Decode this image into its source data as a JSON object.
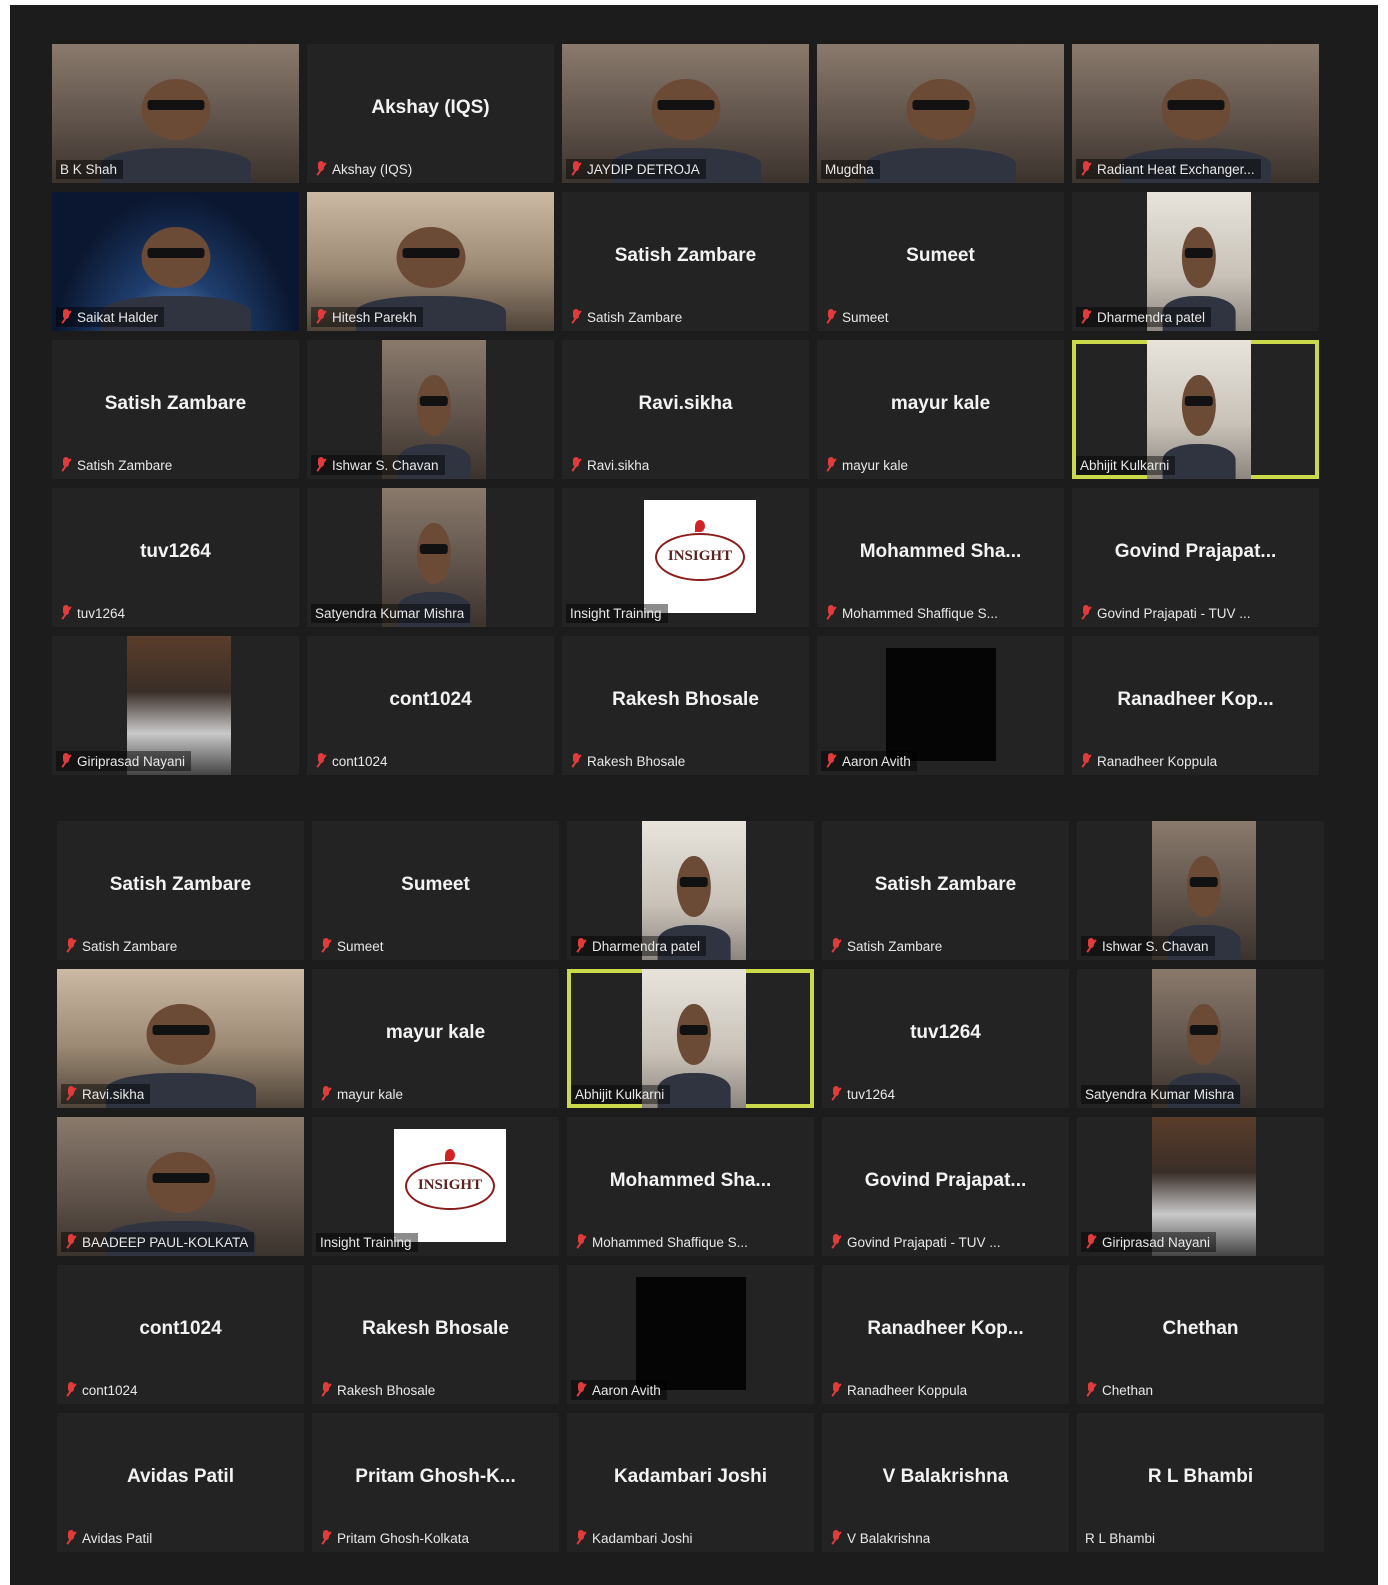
{
  "colors": {
    "background": "#1c1c1c",
    "tile": "#232323",
    "active_border": "#c9d94a",
    "muted_icon": "#e23b3b"
  },
  "panels": [
    {
      "tiles": [
        {
          "name": "",
          "label": "B K Shah",
          "muted": false,
          "video": "full",
          "active": false
        },
        {
          "name": "Akshay (IQS)",
          "label": "Akshay (IQS)",
          "muted": true,
          "video": "none",
          "active": false
        },
        {
          "name": "",
          "label": "JAYDIP DETROJA",
          "muted": true,
          "video": "full",
          "active": false
        },
        {
          "name": "",
          "label": "Mugdha",
          "muted": false,
          "video": "full",
          "active": false
        },
        {
          "name": "",
          "label": "Radiant Heat Exchanger...",
          "muted": true,
          "video": "full",
          "active": false
        },
        {
          "name": "",
          "label": "Saikat Halder",
          "muted": true,
          "video": "space",
          "active": false
        },
        {
          "name": "",
          "label": "Hitesh Parekh",
          "muted": true,
          "video": "room",
          "active": false
        },
        {
          "name": "Satish Zambare",
          "label": "Satish Zambare",
          "muted": true,
          "video": "none",
          "active": false
        },
        {
          "name": "Sumeet",
          "label": "Sumeet",
          "muted": true,
          "video": "none",
          "active": false
        },
        {
          "name": "",
          "label": "Dharmendra patel",
          "muted": true,
          "video": "narrow-bright",
          "active": false
        },
        {
          "name": "Satish Zambare",
          "label": "Satish Zambare",
          "muted": true,
          "video": "none",
          "active": false
        },
        {
          "name": "",
          "label": "Ishwar S. Chavan",
          "muted": true,
          "video": "narrow",
          "active": false
        },
        {
          "name": "Ravi.sikha",
          "label": "Ravi.sikha",
          "muted": true,
          "video": "none",
          "active": false
        },
        {
          "name": "mayur kale",
          "label": "mayur kale",
          "muted": true,
          "video": "none",
          "active": false
        },
        {
          "name": "",
          "label": "Abhijit Kulkarni",
          "muted": false,
          "video": "narrow-bright",
          "active": true
        },
        {
          "name": "tuv1264",
          "label": "tuv1264",
          "muted": true,
          "video": "none",
          "active": false
        },
        {
          "name": "",
          "label": "Satyendra Kumar Mishra",
          "muted": false,
          "video": "narrow",
          "active": false
        },
        {
          "name": "",
          "label": "Insight Training",
          "muted": false,
          "video": "logo",
          "active": false
        },
        {
          "name": "Mohammed  Sha...",
          "label": "Mohammed Shaffique S...",
          "muted": true,
          "video": "none",
          "active": false
        },
        {
          "name": "Govind  Prajapat...",
          "label": "Govind Prajapati - TUV ...",
          "muted": true,
          "video": "none",
          "active": false
        },
        {
          "name": "",
          "label": "Giriprasad Nayani",
          "muted": true,
          "video": "narrow-car",
          "active": false
        },
        {
          "name": "cont1024",
          "label": "cont1024",
          "muted": true,
          "video": "none",
          "active": false
        },
        {
          "name": "Rakesh Bhosale",
          "label": "Rakesh Bhosale",
          "muted": true,
          "video": "none",
          "active": false
        },
        {
          "name": "",
          "label": "Aaron Avith",
          "muted": true,
          "video": "black",
          "active": false
        },
        {
          "name": "Ranadheer  Kop...",
          "label": "Ranadheer Koppula",
          "muted": true,
          "video": "none",
          "active": false
        }
      ]
    },
    {
      "tiles": [
        {
          "name": "Satish Zambare",
          "label": "Satish Zambare",
          "muted": true,
          "video": "none",
          "active": false
        },
        {
          "name": "Sumeet",
          "label": "Sumeet",
          "muted": true,
          "video": "none",
          "active": false
        },
        {
          "name": "",
          "label": "Dharmendra patel",
          "muted": true,
          "video": "narrow-bright",
          "active": false
        },
        {
          "name": "Satish Zambare",
          "label": "Satish Zambare",
          "muted": true,
          "video": "none",
          "active": false
        },
        {
          "name": "",
          "label": "Ishwar S. Chavan",
          "muted": true,
          "video": "narrow",
          "active": false
        },
        {
          "name": "",
          "label": "Ravi.sikha",
          "muted": true,
          "video": "room",
          "active": false
        },
        {
          "name": "mayur kale",
          "label": "mayur kale",
          "muted": true,
          "video": "none",
          "active": false
        },
        {
          "name": "",
          "label": "Abhijit Kulkarni",
          "muted": false,
          "video": "narrow-bright",
          "active": true
        },
        {
          "name": "tuv1264",
          "label": "tuv1264",
          "muted": true,
          "video": "none",
          "active": false
        },
        {
          "name": "",
          "label": "Satyendra Kumar Mishra",
          "muted": false,
          "video": "narrow",
          "active": false
        },
        {
          "name": "",
          "label": "BAADEEP PAUL-KOLKATA",
          "muted": true,
          "video": "full",
          "active": false
        },
        {
          "name": "",
          "label": "Insight Training",
          "muted": false,
          "video": "logo",
          "active": false
        },
        {
          "name": "Mohammed  Sha...",
          "label": "Mohammed Shaffique S...",
          "muted": true,
          "video": "none",
          "active": false
        },
        {
          "name": "Govind  Prajapat...",
          "label": "Govind Prajapati - TUV ...",
          "muted": true,
          "video": "none",
          "active": false
        },
        {
          "name": "",
          "label": "Giriprasad Nayani",
          "muted": true,
          "video": "narrow-car",
          "active": false
        },
        {
          "name": "cont1024",
          "label": "cont1024",
          "muted": true,
          "video": "none",
          "active": false
        },
        {
          "name": "Rakesh Bhosale",
          "label": "Rakesh Bhosale",
          "muted": true,
          "video": "none",
          "active": false
        },
        {
          "name": "",
          "label": "Aaron Avith",
          "muted": true,
          "video": "black",
          "active": false
        },
        {
          "name": "Ranadheer  Kop...",
          "label": "Ranadheer Koppula",
          "muted": true,
          "video": "none",
          "active": false
        },
        {
          "name": "Chethan",
          "label": "Chethan",
          "muted": true,
          "video": "none",
          "active": false
        },
        {
          "name": "Avidas Patil",
          "label": "Avidas Patil",
          "muted": true,
          "video": "none",
          "active": false
        },
        {
          "name": "Pritam  Ghosh-K...",
          "label": "Pritam Ghosh-Kolkata",
          "muted": true,
          "video": "none",
          "active": false
        },
        {
          "name": "Kadambari Joshi",
          "label": "Kadambari Joshi",
          "muted": true,
          "video": "none",
          "active": false
        },
        {
          "name": "V Balakrishna",
          "label": "V Balakrishna",
          "muted": true,
          "video": "none",
          "active": false
        },
        {
          "name": "R L Bhambi",
          "label": "R L Bhambi",
          "muted": false,
          "video": "none",
          "active": false
        }
      ]
    }
  ],
  "logo": {
    "text": "INSIGHT"
  }
}
